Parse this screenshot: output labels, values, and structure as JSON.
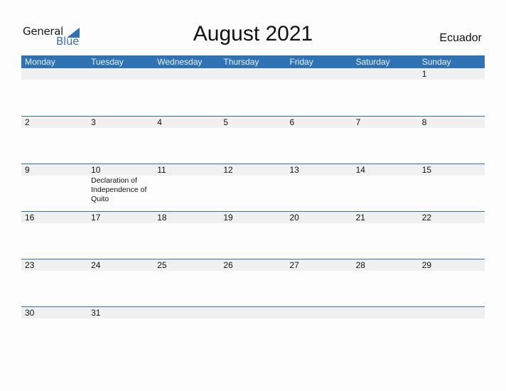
{
  "logo": {
    "line1": "General",
    "line2": "Blue"
  },
  "title": "August 2021",
  "country": "Ecuador",
  "colors": {
    "accent": "#2f73b4",
    "strip": "#f0f0f0"
  },
  "weekdays": [
    "Monday",
    "Tuesday",
    "Wednesday",
    "Thursday",
    "Friday",
    "Saturday",
    "Sunday"
  ],
  "weeks": [
    [
      {
        "d": ""
      },
      {
        "d": ""
      },
      {
        "d": ""
      },
      {
        "d": ""
      },
      {
        "d": ""
      },
      {
        "d": ""
      },
      {
        "d": "1"
      }
    ],
    [
      {
        "d": "2"
      },
      {
        "d": "3"
      },
      {
        "d": "4"
      },
      {
        "d": "5"
      },
      {
        "d": "6"
      },
      {
        "d": "7"
      },
      {
        "d": "8"
      }
    ],
    [
      {
        "d": "9"
      },
      {
        "d": "10",
        "event": "Declaration of Independence of Quito"
      },
      {
        "d": "11"
      },
      {
        "d": "12"
      },
      {
        "d": "13"
      },
      {
        "d": "14"
      },
      {
        "d": "15"
      }
    ],
    [
      {
        "d": "16"
      },
      {
        "d": "17"
      },
      {
        "d": "18"
      },
      {
        "d": "19"
      },
      {
        "d": "20"
      },
      {
        "d": "21"
      },
      {
        "d": "22"
      }
    ],
    [
      {
        "d": "23"
      },
      {
        "d": "24"
      },
      {
        "d": "25"
      },
      {
        "d": "26"
      },
      {
        "d": "27"
      },
      {
        "d": "28"
      },
      {
        "d": "29"
      }
    ],
    [
      {
        "d": "30"
      },
      {
        "d": "31"
      },
      {
        "d": ""
      },
      {
        "d": ""
      },
      {
        "d": ""
      },
      {
        "d": ""
      },
      {
        "d": ""
      }
    ]
  ]
}
